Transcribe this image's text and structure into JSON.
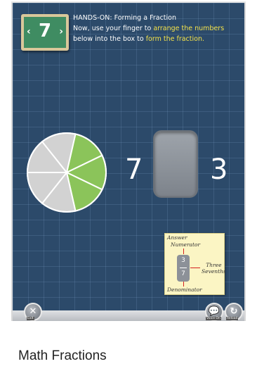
{
  "badge": {
    "number": "7",
    "left_arrow": "‹",
    "right_arrow": "›"
  },
  "instructions": {
    "line1": "HANDS-ON: Forming a Fraction",
    "line2_a": "Now, use your finger to ",
    "line2_hl": "arrange the numbers",
    "line3_a": "below into the box to ",
    "line3_hl": "form the fraction."
  },
  "pie": {
    "total_slices": 7,
    "shaded_slices": 3,
    "shaded_color": "#8bc45a",
    "unshaded_color": "#d2d2d2"
  },
  "tiles": {
    "left_number": "7",
    "right_number": "3"
  },
  "answer_card": {
    "title": "Answer",
    "numerator_label": "Numerator",
    "denominator_label": "Denominator",
    "fraction_top": "3",
    "fraction_bottom": "7",
    "word_1": "Three",
    "word_2": "Sevenths"
  },
  "toolbar": {
    "exit_label": "Exit",
    "voice_label": "Voice On",
    "reload_label": "Reload"
  },
  "caption": "Math Fractions"
}
